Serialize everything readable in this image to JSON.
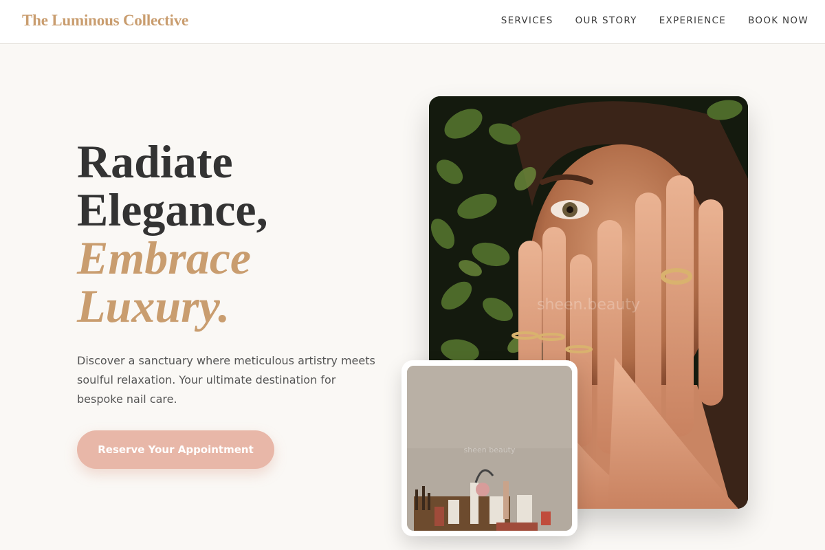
{
  "nav": {
    "brand": "The Luminous Collective",
    "links": [
      "SERVICES",
      "OUR STORY",
      "EXPERIENCE",
      "BOOK NOW"
    ]
  },
  "hero": {
    "title_lines": [
      "Radiate",
      "Elegance,"
    ],
    "accent_lines": [
      "Embrace",
      "Luxury."
    ],
    "description": "Discover a sanctuary where meticulous artistry meets soulful relaxation. Your ultimate destination for bespoke nail care.",
    "cta_label": "Reserve Your Appointment"
  },
  "images": {
    "main_watermark": "sheen.beauty",
    "small_watermark": "sheen beauty"
  },
  "colors": {
    "accent": "#c99d6f",
    "cta": "#e8b7a8",
    "background": "#faf8f5"
  }
}
